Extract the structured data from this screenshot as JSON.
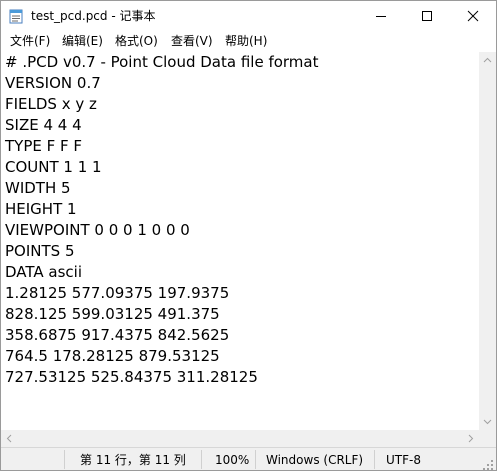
{
  "window": {
    "title": "test_pcd.pcd - 记事本"
  },
  "menu": {
    "items": [
      "文件(F)",
      "编辑(E)",
      "格式(O)",
      "查看(V)",
      "帮助(H)"
    ]
  },
  "editor": {
    "lines": [
      "# .PCD v0.7 - Point Cloud Data file format",
      "VERSION 0.7",
      "FIELDS x y z",
      "SIZE 4 4 4",
      "TYPE F F F",
      "COUNT 1 1 1",
      "WIDTH 5",
      "HEIGHT 1",
      "VIEWPOINT 0 0 0 1 0 0 0",
      "POINTS 5",
      "DATA ascii",
      "1.28125 577.09375 197.9375",
      "828.125 599.03125 491.375",
      "358.6875 917.4375 842.5625",
      "764.5 178.28125 879.53125",
      "727.53125 525.84375 311.28125"
    ]
  },
  "status": {
    "position": "第 11 行，第 11 列",
    "zoom": "100%",
    "line_ending": "Windows (CRLF)",
    "encoding": "UTF-8"
  },
  "icons": {
    "app": "notepad-icon",
    "minimize": "minimize-icon",
    "maximize": "maximize-icon",
    "close": "close-icon"
  }
}
